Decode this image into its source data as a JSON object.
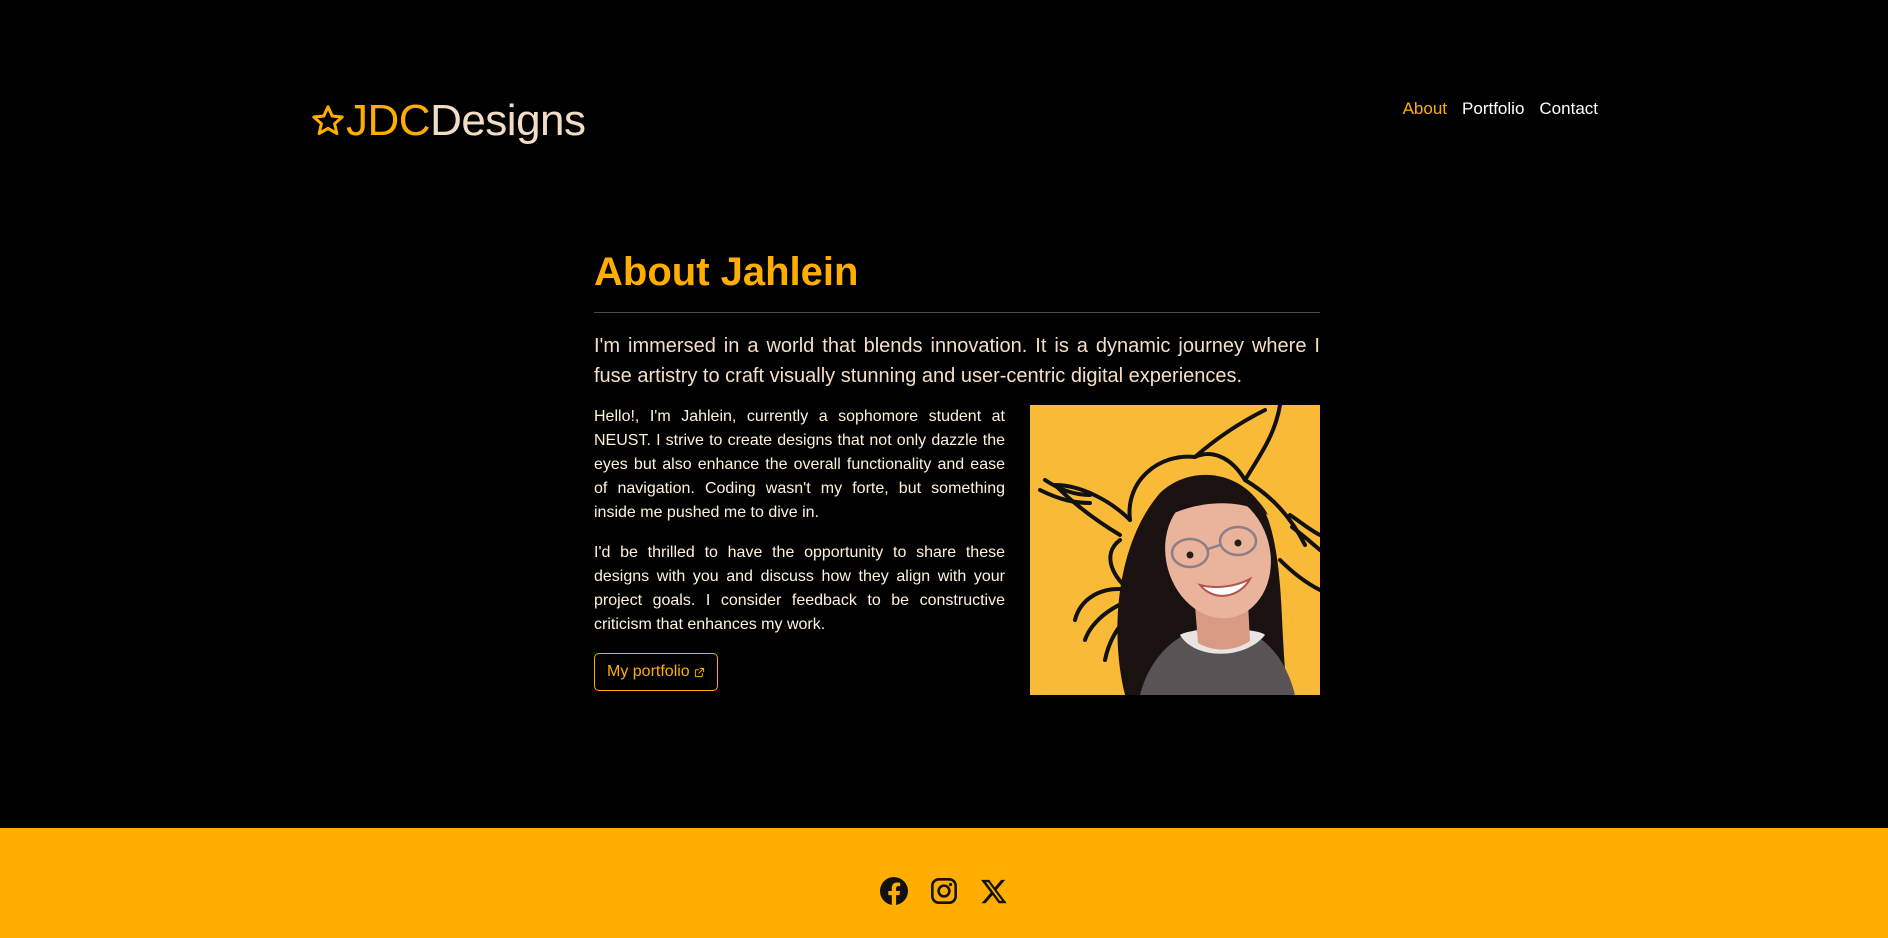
{
  "brand": {
    "logo_icon": "star-outline-icon",
    "part1": "JDC",
    "part2": "Designs",
    "accent_color": "#FFAE00",
    "secondary_color": "#F2DCC4"
  },
  "nav": {
    "items": [
      {
        "label": "About",
        "active": true
      },
      {
        "label": "Portfolio",
        "active": false
      },
      {
        "label": "Contact",
        "active": false
      }
    ]
  },
  "about": {
    "title": "About Jahlein",
    "lead": "I'm immersed in a world that blends innovation. It is a dynamic journey where I fuse artistry to craft visually stunning and user-centric digital experiences.",
    "paragraphs": [
      "Hello!, I'm Jahlein, currently a sophomore student at NEUST. I strive to create designs that not only dazzle the eyes but also enhance the overall functionality and ease of navigation. Coding wasn't my forte, but something inside me pushed me to dive in.",
      "I'd be thrilled to have the opportunity to share these designs with you and discuss how they align with your project goals. I consider feedback to be constructive criticism that enhances my work."
    ],
    "button_label": "My portfolio",
    "button_icon": "external-link-icon",
    "photo_background": "#F8BA37"
  },
  "footer": {
    "background": "#FFAE00",
    "socials": [
      {
        "icon": "facebook-icon"
      },
      {
        "icon": "instagram-icon"
      },
      {
        "icon": "x-twitter-icon"
      }
    ]
  }
}
